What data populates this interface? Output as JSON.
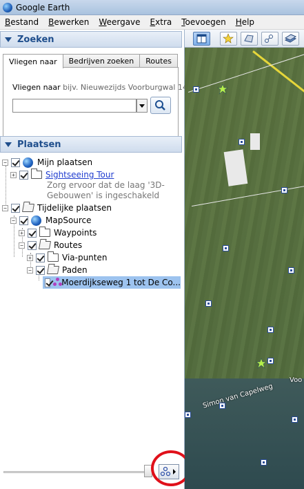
{
  "window": {
    "title": "Google Earth"
  },
  "menu": [
    "Bestand",
    "Bewerken",
    "Weergave",
    "Extra",
    "Toevoegen",
    "Help"
  ],
  "search_panel": {
    "title": "Zoeken",
    "tabs": [
      "Vliegen naar",
      "Bedrijven zoeken",
      "Routes"
    ],
    "fly_label": "Vliegen naar",
    "fly_hint": "bijv. Nieuwezijds Voorburgwal 147,",
    "input_value": ""
  },
  "places_panel": {
    "title": "Plaatsen",
    "items": {
      "my_places": "Mijn plaatsen",
      "sightseeing": "Sightseeing Tour",
      "sightseeing_desc": "Zorg ervoor dat de laag '3D-Gebouwen' is ingeschakeld",
      "temp_places": "Tijdelijke plaatsen",
      "mapsource": "MapSource",
      "waypoints": "Waypoints",
      "routes": "Routes",
      "via_points": "Via-punten",
      "paths": "Paden",
      "path_item": "Moerdijkseweg 1 tot De Co..."
    }
  },
  "map": {
    "road_label_1": "Simon van Capelweg",
    "road_label_2": "Voo"
  },
  "colors": {
    "accent": "#1f4e8c",
    "selection": "#9dc3ef",
    "highlight_ring": "#e0101a"
  }
}
